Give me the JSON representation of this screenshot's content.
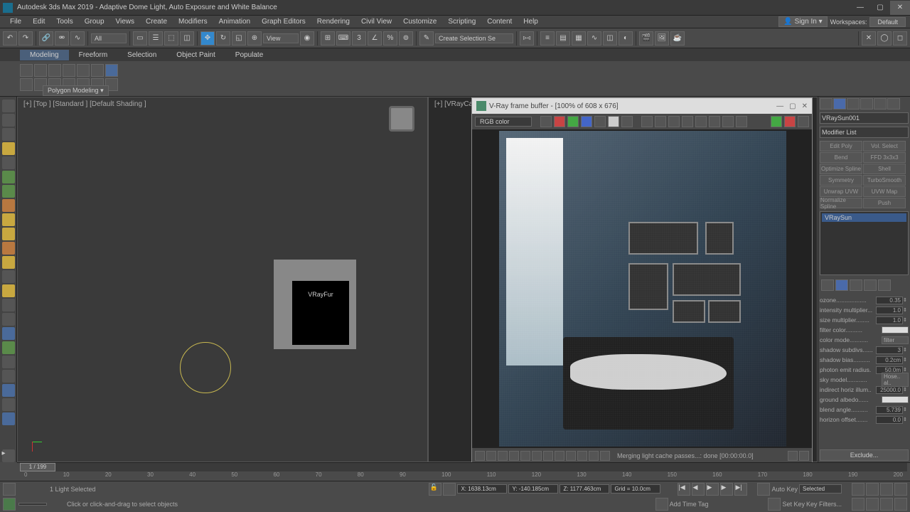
{
  "title": "Autodesk 3ds Max 2019 - Adaptive Dome Light, Auto Exposure and White Balance",
  "menus": [
    "File",
    "Edit",
    "Tools",
    "Group",
    "Views",
    "Create",
    "Modifiers",
    "Animation",
    "Graph Editors",
    "Rendering",
    "Civil View",
    "Customize",
    "Scripting",
    "Content",
    "Help"
  ],
  "signin": "Sign In",
  "workspaces_label": "Workspaces:",
  "workspaces_value": "Default",
  "toolbar_all": "All",
  "toolbar_view": "View",
  "sel_filter": "Create Selection Se",
  "ribbon_tabs": [
    "Modeling",
    "Freeform",
    "Selection",
    "Object Paint",
    "Populate"
  ],
  "poly_modeling": "Polygon Modeling",
  "vp_left_label": "[+] [Top ] [Standard ] [Default Shading ]",
  "vp_right_label": "[+] [VRayCam",
  "vp_scene_label": "VRayFur",
  "vfb": {
    "title": "V-Ray frame buffer - [100% of 608 x 676]",
    "channel": "RGB color",
    "status": "Merging light cache passes...: done [00:00:00.0]"
  },
  "panel": {
    "object_name": "VRaySun001",
    "modifier_list": "Modifier List",
    "mod_buttons": [
      "Edit Poly",
      "Vol. Select",
      "Bend",
      "FFD 3x3x3",
      "Optimize Spline",
      "Shell",
      "Symmetry",
      "TurboSmooth",
      "Unwrap UVW",
      "UVW Map",
      "Normalize Spline",
      "Push"
    ],
    "stack_item": "VRaySun",
    "params": [
      {
        "label": "ozone..................",
        "val": "0.35"
      },
      {
        "label": "intensity multiplier...",
        "val": "1.0"
      },
      {
        "label": "size multiplier........",
        "val": "1.0"
      },
      {
        "label": "filter color..........",
        "type": "swatch"
      },
      {
        "label": "color mode...........",
        "type": "drop",
        "val": "filter"
      },
      {
        "label": "shadow subdivs......",
        "val": "3"
      },
      {
        "label": "shadow bias..........",
        "val": "0.2cm"
      },
      {
        "label": "photon emit radius.",
        "val": "50.0m"
      },
      {
        "label": "sky model............",
        "type": "drop",
        "val": "Hose.. al.."
      },
      {
        "label": "indirect horiz illum..",
        "val": "25000.0"
      },
      {
        "label": "ground albedo......",
        "type": "swatch"
      },
      {
        "label": "blend angle..........",
        "val": "5.739"
      },
      {
        "label": "horizon offset.......",
        "val": "0.0"
      }
    ],
    "exclude": "Exclude..."
  },
  "timeline": {
    "frame": "1 / 199",
    "ticks": [
      "0",
      "10",
      "20",
      "30",
      "40",
      "50",
      "60",
      "70",
      "80",
      "90",
      "100",
      "110",
      "120",
      "130",
      "140",
      "150",
      "160",
      "170",
      "180",
      "190",
      "200"
    ]
  },
  "status": {
    "selection": "1 Light Selected",
    "prompt": "Click or click-and-drag to select objects",
    "x": "X: 1638.13cm",
    "y": "Y: -140.185cm",
    "z": "Z: 1177.463cm",
    "grid": "Grid = 10.0cm",
    "addtime": "Add Time Tag",
    "autokey": "Auto Key",
    "setkey": "Set Key",
    "selected": "Selected",
    "keyfilters": "Key Filters..."
  }
}
